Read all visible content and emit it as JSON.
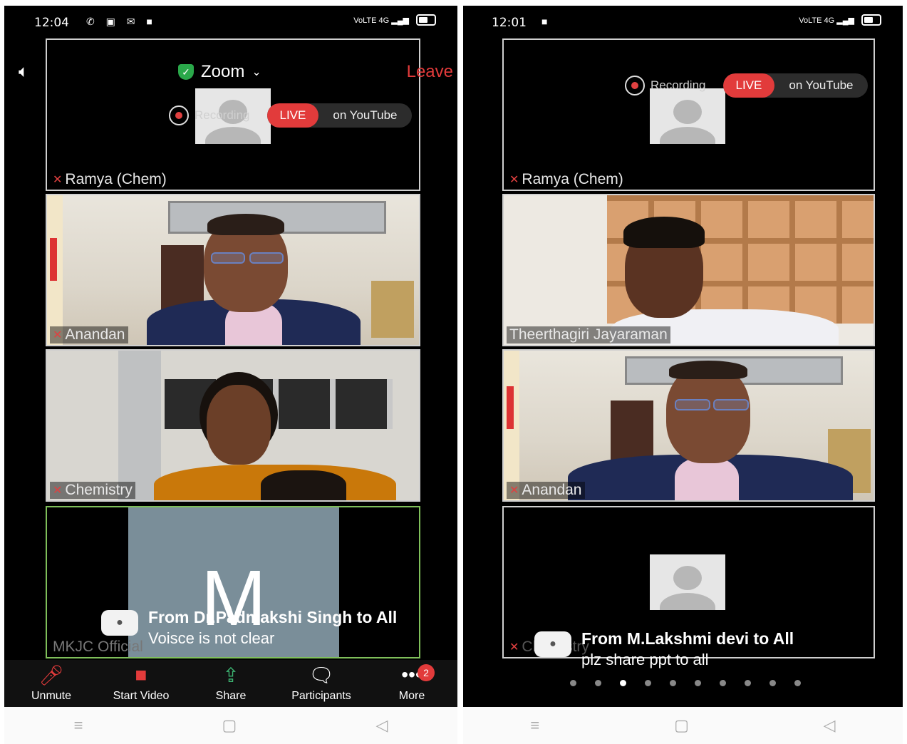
{
  "left": {
    "status": {
      "time": "12:04",
      "left_icons": "✆ ▣ ✉ ■",
      "right_icons": "VoLTE 4G ▂▄▆"
    },
    "header": {
      "app_title": "Zoom",
      "leave_label": "Leave"
    },
    "recording": {
      "label": "Recording",
      "live": "LIVE",
      "platform": "on YouTube"
    },
    "tiles": [
      {
        "name": "Ramya (Chem)"
      },
      {
        "name": "Anandan"
      },
      {
        "name": "Chemistry"
      },
      {
        "name": "MKJC Official",
        "initial": "M"
      }
    ],
    "chat": {
      "from": "From Dr.Padmakshi Singh to All",
      "message": "Voisce is not clear"
    },
    "toolbar": {
      "unmute": "Unmute",
      "start_video": "Start Video",
      "share": "Share",
      "participants": "Participants",
      "more": "More",
      "more_badge": "2"
    }
  },
  "right": {
    "status": {
      "time": "12:01",
      "left_icons": "■",
      "right_icons": "VoLTE 4G ▂▄▆"
    },
    "recording": {
      "label": "Recording",
      "live": "LIVE",
      "platform": "on YouTube"
    },
    "tiles": [
      {
        "name": "Ramya (Chem)"
      },
      {
        "name": "Theerthagiri Jayaraman"
      },
      {
        "name": "Anandan"
      },
      {
        "name": "Chemistry"
      }
    ],
    "chat": {
      "from": "From M.Lakshmi devi to All",
      "message": "plz share ppt to all"
    },
    "page_dots": {
      "count": 10,
      "active": 2
    }
  },
  "navbar": {
    "menu": "≡",
    "home": "▢",
    "back": "◁"
  },
  "colors": {
    "live_red": "#e23b3b",
    "shield_green": "#2aa84a",
    "active_border": "#7fbf5a"
  }
}
